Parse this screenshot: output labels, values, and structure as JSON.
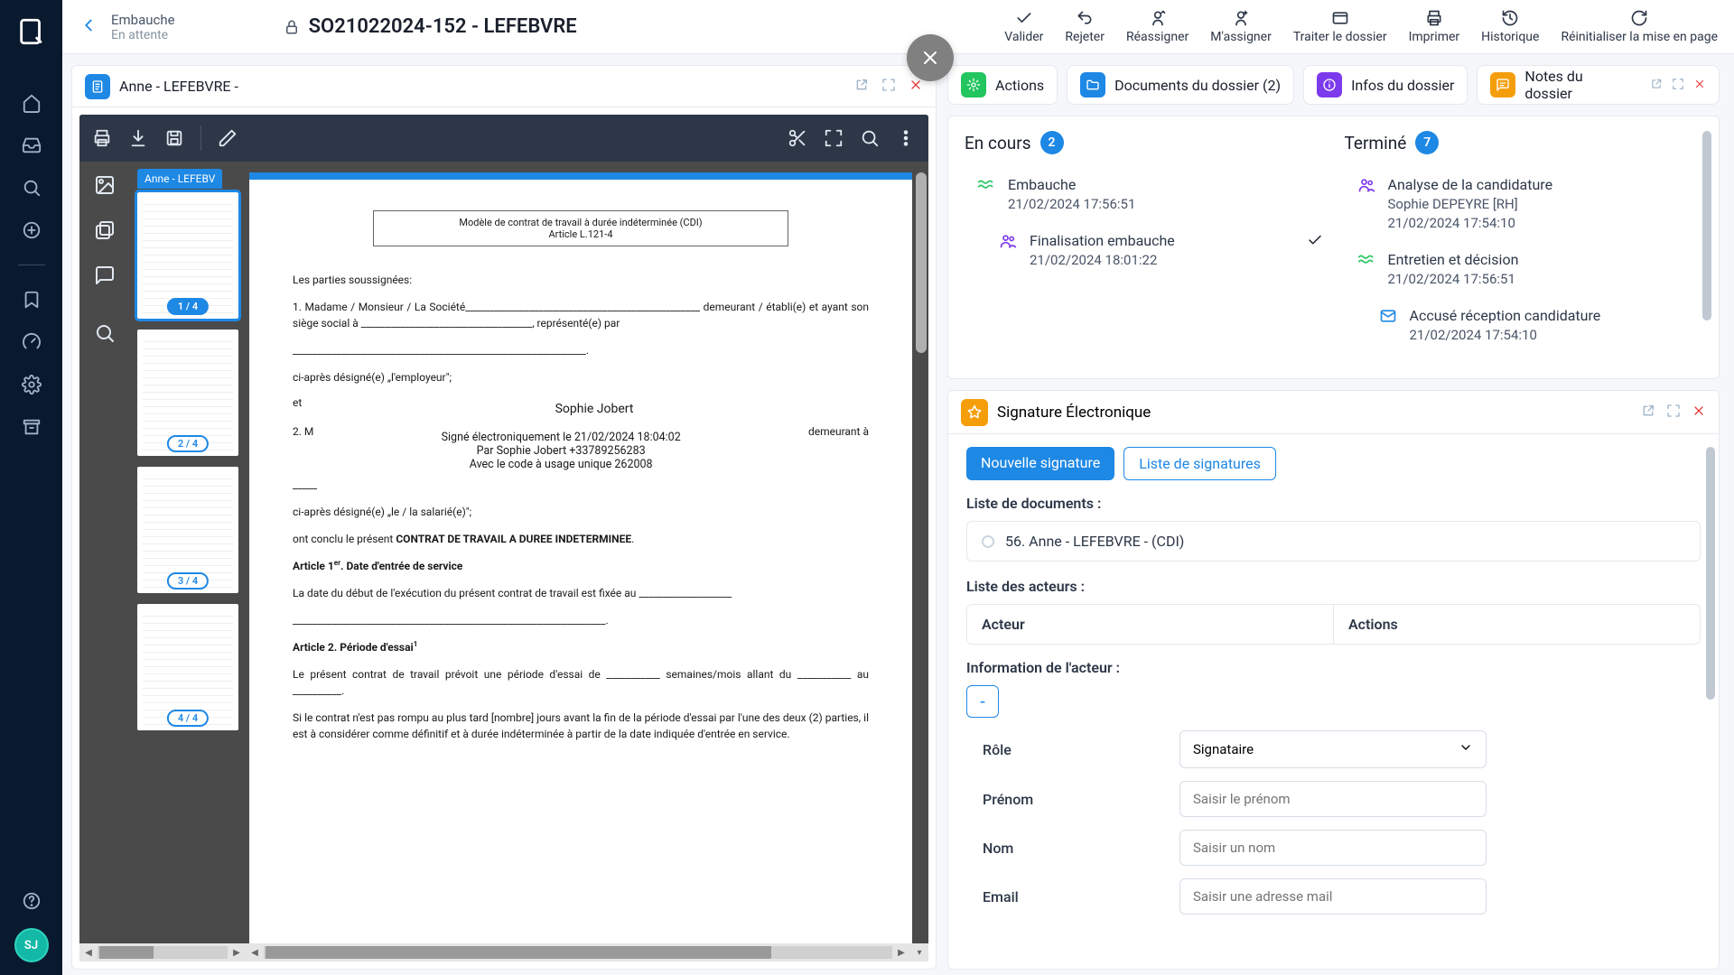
{
  "rail": {
    "avatar": "SJ"
  },
  "header": {
    "breadcrumb": {
      "title": "Embauche",
      "status": "En attente"
    },
    "lock": true,
    "case_title": "SO21022024-152 - LEFEBVRE",
    "actions": {
      "validate": "Valider",
      "reject": "Rejeter",
      "reassign": "Réassigner",
      "assign_me": "M'assigner",
      "process": "Traiter le dossier",
      "print": "Imprimer",
      "history": "Historique",
      "reset_layout": "Réinitialiser la mise en page"
    }
  },
  "doc_panel": {
    "tab_label": "Anne - LEFEBVRE -",
    "thumb_tab": "Anne - LEFEBV",
    "pages": [
      "1 / 4",
      "2 / 4",
      "3 / 4",
      "4 / 4"
    ],
    "content": {
      "box_l1": "Modèle de contrat de travail à durée indéterminée (CDI)",
      "box_l2": "Article L.121-4",
      "p1": "Les parties soussignées:",
      "p2": "1. Madame / Monsieur / La Société________________________________________________ demeurant / établi(e) et ayant son siège social à ___________________________________, représenté(e) par",
      "p2b": "____________________________________________________________.",
      "p3": "ci-après désigné(e) „l'employeur\";",
      "p_et": "et",
      "signame": "Sophie Jobert",
      "p4_pre": "2.  M",
      "p4_post": "demeurant  à",
      "p4_line": "_____",
      "sig_l1": "Signé électroniquement le 21/02/2024 18:04:02",
      "sig_l2": "Par Sophie Jobert +33789256283",
      "sig_l3": "Avec le code à usage unique 262008",
      "p5": "ci-après désigné(e) „le / la salarié(e)\";",
      "p6_a": "ont conclu le présent ",
      "p6_b": "CONTRAT DE TRAVAIL A DUREE INDETERMINEE",
      "p6_c": ".",
      "h1_a": "Article 1",
      "h1_sup": "er",
      "h1_b": ". Date d'entrée de service",
      "p7": "La date du début de l'exécution du présent contrat de travail est fixée au ___________________",
      "p7b": "________________________________________________________________.",
      "h2": "Article 2. Période d'essai",
      "h2_sup": "1",
      "p8": "Le présent contrat de travail prévoit une période d'essai de ___________ semaines/mois allant du ___________ au __________.",
      "p9": "Si le contrat n'est pas rompu au plus tard [nombre] jours avant la fin de la période d'essai par l'une des deux (2) parties, il est à considérer comme définitif et à durée indéterminée à partir de la date indiquée d'entrée en service."
    }
  },
  "right_tabs": {
    "actions": "Actions",
    "docs": "Documents du dossier (2)",
    "infos": "Infos du dossier",
    "notes": "Notes du dossier"
  },
  "workflow": {
    "in_progress": {
      "label": "En cours",
      "count": "2"
    },
    "done": {
      "label": "Terminé",
      "count": "7"
    },
    "ip_items": [
      {
        "name": "Embauche",
        "date": "21/02/2024 17:56:51",
        "icon": "wave"
      },
      {
        "name": "Finalisation embauche",
        "date": "21/02/2024 18:01:22",
        "icon": "people",
        "check": true
      }
    ],
    "done_items": [
      {
        "name": "Analyse de la candidature",
        "user": "Sophie DEPEYRE [RH]",
        "date": "21/02/2024 17:54:10",
        "icon": "people"
      },
      {
        "name": "Entretien et décision",
        "date": "21/02/2024 17:56:51",
        "icon": "wave"
      },
      {
        "name": "Accusé réception candidature",
        "date": "21/02/2024 17:54:10",
        "icon": "mail"
      }
    ]
  },
  "signature": {
    "title": "Signature Électronique",
    "tab_new": "Nouvelle signature",
    "tab_list": "Liste de signatures",
    "docs_label": "Liste de documents :",
    "doc_name": "56. Anne - LEFEBVRE - (CDI)",
    "actors_label": "Liste des acteurs :",
    "col_actor": "Acteur",
    "col_actions": "Actions",
    "actor_info_label": "Information de l'acteur :",
    "minus": "-",
    "fields": {
      "role_label": "Rôle",
      "role_value": "Signataire",
      "firstname_label": "Prénom",
      "firstname_ph": "Saisir le prénom",
      "lastname_label": "Nom",
      "lastname_ph": "Saisir un nom",
      "email_label": "Email",
      "email_ph": "Saisir une adresse mail"
    }
  }
}
